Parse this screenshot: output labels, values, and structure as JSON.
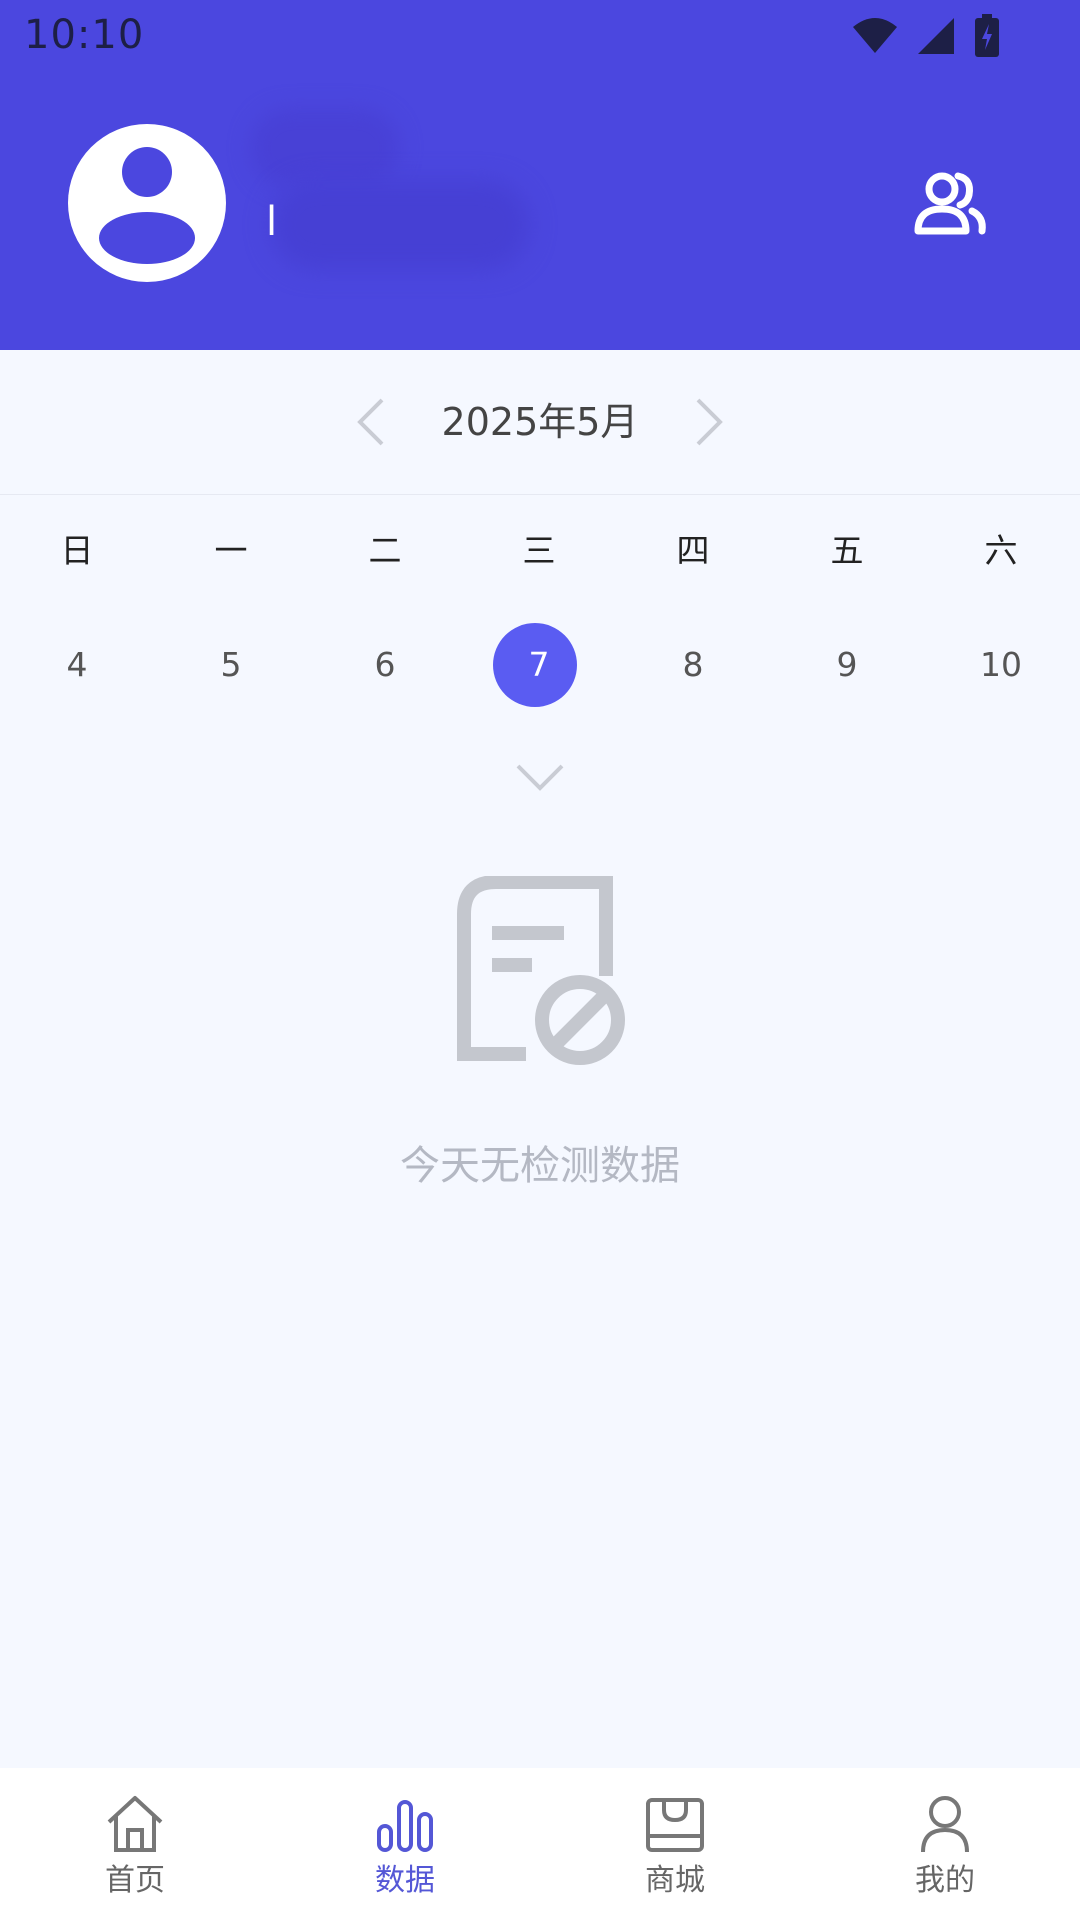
{
  "status_bar": {
    "time": "10:10"
  },
  "header": {
    "background": "#4b47df",
    "avatar_icon": "user-avatar-icon",
    "user_name_char": "l",
    "friends_icon": "friends-icon"
  },
  "calendar": {
    "month_label": "2025年5月",
    "prev_icon": "chevron-left-icon",
    "next_icon": "chevron-right-icon",
    "weekdays": [
      "日",
      "一",
      "二",
      "三",
      "四",
      "五",
      "六"
    ],
    "dates": [
      "4",
      "5",
      "6",
      "7",
      "8",
      "9",
      "10"
    ],
    "selected_date": "7",
    "selected_color": "#5a5cf2",
    "expand_icon": "chevron-down-icon"
  },
  "empty_state": {
    "icon": "no-document-icon",
    "message": "今天无检测数据"
  },
  "bottom_nav": {
    "active_color": "#5457d6",
    "items": [
      {
        "label": "首页",
        "icon": "home-icon",
        "active": false
      },
      {
        "label": "数据",
        "icon": "bar-chart-icon",
        "active": true
      },
      {
        "label": "商城",
        "icon": "shop-bag-icon",
        "active": false
      },
      {
        "label": "我的",
        "icon": "person-icon",
        "active": false
      }
    ]
  }
}
